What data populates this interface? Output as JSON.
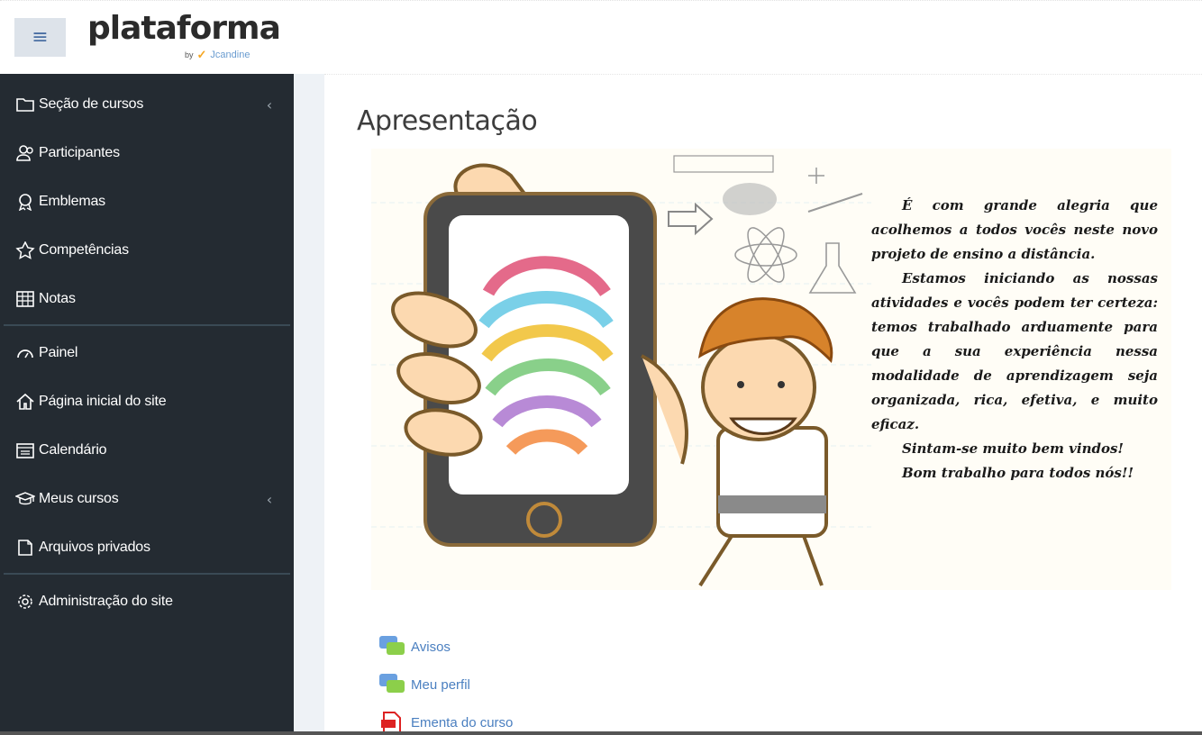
{
  "header": {
    "menu_icon": "hamburger-icon",
    "logo_text": "plataforma",
    "logo_by": "by",
    "logo_brand": "Jcandine"
  },
  "sidebar": {
    "items": [
      {
        "label": "Seção de cursos",
        "icon": "folder-icon"
      },
      {
        "label": "Participantes",
        "icon": "users-icon"
      },
      {
        "label": "Emblemas",
        "icon": "badge-icon"
      },
      {
        "label": "Competências",
        "icon": "star-icon"
      },
      {
        "label": "Notas",
        "icon": "table-icon"
      },
      {
        "label": "Painel",
        "icon": "dashboard-icon"
      },
      {
        "label": "Página inicial do site",
        "icon": "home-icon"
      },
      {
        "label": "Calendário",
        "icon": "calendar-icon"
      },
      {
        "label": "Meus cursos",
        "icon": "graduation-cap-icon"
      },
      {
        "label": "Arquivos privados",
        "icon": "file-icon"
      },
      {
        "label": "Administração do site",
        "icon": "gear-icon"
      }
    ]
  },
  "main": {
    "title": "Apresentação",
    "welcome_paragraphs": [
      "É com grande alegria que acolhemos a todos vocês neste novo projeto de ensino a distância.",
      "Estamos iniciando as nossas atividades e vocês podem ter certeza: temos trabalhado arduamente para que a sua experiência nessa modalidade de aprendizagem seja organizada, rica, efetiva, e muito eficaz.",
      "Sintam-se muito bem vindos!",
      "Bom trabalho para todos nós!!"
    ],
    "links": [
      {
        "label": "Avisos",
        "icon": "forum-icon"
      },
      {
        "label": "Meu perfil",
        "icon": "forum-icon"
      },
      {
        "label": "Ementa do curso",
        "icon": "pdf-icon"
      }
    ]
  },
  "colors": {
    "sidebar_bg": "#242b32",
    "link": "#4a7fc0",
    "accent_brown": "#c97a2a"
  }
}
